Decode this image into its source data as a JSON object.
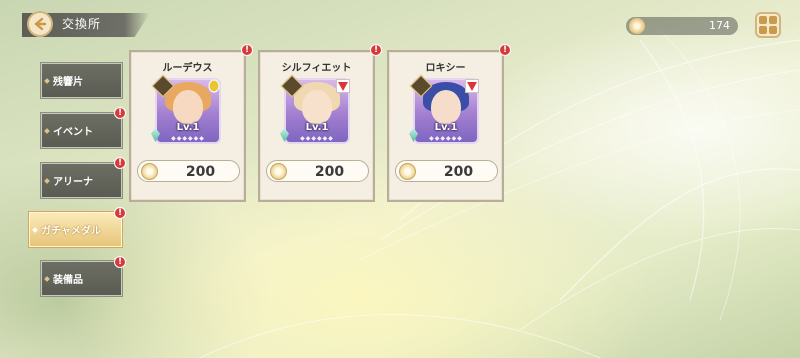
{
  "header": {
    "title": "交換所"
  },
  "currency": {
    "value": "174",
    "icon": "medal-coin-icon"
  },
  "sidebar": {
    "items": [
      {
        "label": "残響片",
        "active": false,
        "badge": ""
      },
      {
        "label": "イベント",
        "active": false,
        "badge": "!"
      },
      {
        "label": "アリーナ",
        "active": false,
        "badge": "!"
      },
      {
        "label": "ガチャメダル",
        "active": true,
        "badge": "!"
      },
      {
        "label": "装備品",
        "active": false,
        "badge": "!"
      }
    ]
  },
  "cards": [
    {
      "name": "ルーデウス",
      "level": "Lv.1",
      "price": "200",
      "badge": "!",
      "hair_color": "#e9a860",
      "type_color": "#e8c531"
    },
    {
      "name": "シルフィエット",
      "level": "Lv.1",
      "price": "200",
      "badge": "!",
      "hair_color": "#f0d9b0",
      "type_color": "#d93636"
    },
    {
      "name": "ロキシー",
      "level": "Lv.1",
      "price": "200",
      "badge": "!",
      "hair_color": "#3a4ea8",
      "type_color": "#d93636"
    }
  ],
  "colors": {
    "badge": "#d63a3a",
    "active_tab": "#e6c57a",
    "tab": "#5a5b52",
    "card_bg": "#f4efe2"
  }
}
